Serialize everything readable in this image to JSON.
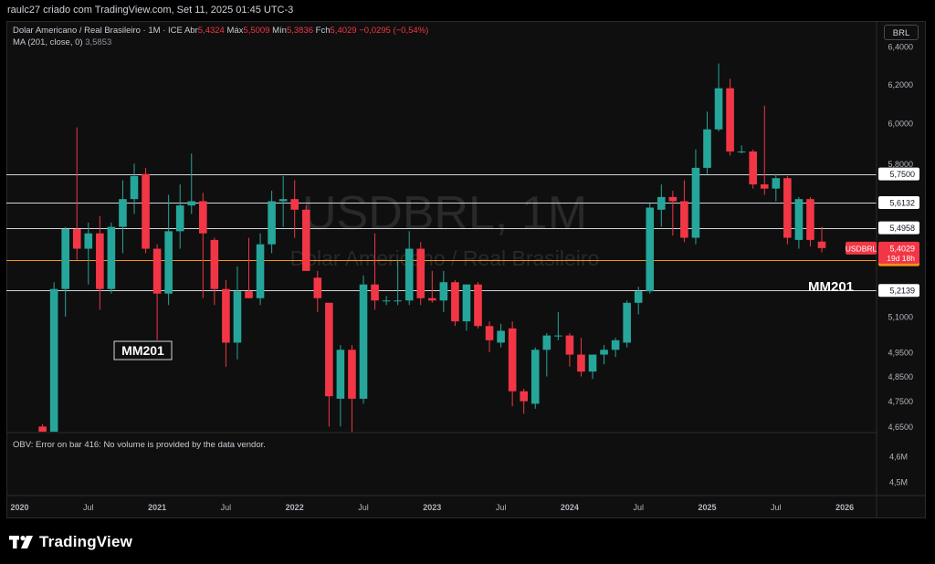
{
  "header": {
    "caption": "raulc27 criado com TradingView.com, Set 11, 2025 01:45 UTC-3"
  },
  "legend": {
    "instrument": "Dolar Americano / Real Brasileiro · 1M · ICE",
    "open_label": "Abr",
    "open_value": "5,4324",
    "high_label": "Máx",
    "high_value": "5,5009",
    "low_label": "Mín",
    "low_value": "5,3836",
    "close_label": "Fch",
    "close_value": "5,4029",
    "change": "−0,0295 (−0,54%)",
    "ma_label": "MA (201, close, 0)",
    "ma_value": "3,5853"
  },
  "currency_button": "BRL",
  "watermark": {
    "symbol": "USDBRL, 1M",
    "name": "Dolar Americano / Real Brasileiro"
  },
  "obv_message": "OBV: Error on bar 416: No volume is provided by the data vendor.",
  "brand": "TradingView",
  "colors": {
    "up": "#26a69a",
    "down": "#f23645",
    "level_line": "#d1d4dc",
    "ma_line": "#f7931a",
    "background": "#0f0f0f"
  },
  "chart_data": {
    "type": "candlestick",
    "interval": "1M",
    "symbol": "USDBRL",
    "y_range": [
      4.63,
      6.44
    ],
    "y_scale": "log",
    "y_ticks": [
      "6,4000",
      "6,2000",
      "6,0000",
      "5,8000",
      "5,1000",
      "4,9500",
      "4,8500",
      "4,7500",
      "4,6500"
    ],
    "volume_ticks": [
      "4,6M",
      "4,5M"
    ],
    "x_labels": [
      "2020",
      "Jul",
      "2021",
      "Jul",
      "2022",
      "Jul",
      "2023",
      "Jul",
      "2024",
      "Jul",
      "2025",
      "Jul",
      "2026"
    ],
    "x_label_months": [
      0,
      6,
      12,
      18,
      24,
      30,
      36,
      42,
      48,
      54,
      60,
      66,
      72
    ],
    "levels": [
      {
        "value": 5.75,
        "label": "5,7500"
      },
      {
        "value": 5.6132,
        "label": "5,6132"
      },
      {
        "value": 5.4958,
        "label": "5,4958"
      },
      {
        "value": 5.2139,
        "label": "5,2139"
      }
    ],
    "ma": {
      "name": "MA (201, close, 0)",
      "value": 5.3503,
      "label": "5,3503",
      "annotations": [
        "MM201",
        "MM201"
      ]
    },
    "last_price": {
      "symbol": "USDBRL",
      "value": 5.4029,
      "label": "5,4029",
      "countdown": "19d 18h"
    },
    "candles": [
      {
        "m": 2,
        "o": 4.65,
        "h": 4.66,
        "l": 4.6,
        "c": 4.63
      },
      {
        "m": 3,
        "o": 4.63,
        "h": 5.25,
        "l": 4.6,
        "c": 5.22
      },
      {
        "m": 4,
        "o": 5.22,
        "h": 5.5,
        "l": 5.1,
        "c": 5.49
      },
      {
        "m": 5,
        "o": 5.49,
        "h": 5.98,
        "l": 5.35,
        "c": 5.4
      },
      {
        "m": 6,
        "o": 5.4,
        "h": 5.52,
        "l": 5.24,
        "c": 5.47
      },
      {
        "m": 7,
        "o": 5.47,
        "h": 5.55,
        "l": 5.13,
        "c": 5.22
      },
      {
        "m": 8,
        "o": 5.22,
        "h": 5.52,
        "l": 5.2,
        "c": 5.5
      },
      {
        "m": 9,
        "o": 5.5,
        "h": 5.72,
        "l": 5.38,
        "c": 5.63
      },
      {
        "m": 10,
        "o": 5.63,
        "h": 5.8,
        "l": 5.56,
        "c": 5.74
      },
      {
        "m": 11,
        "o": 5.75,
        "h": 5.78,
        "l": 5.38,
        "c": 5.4
      },
      {
        "m": 12,
        "o": 5.4,
        "h": 5.42,
        "l": 5.0,
        "c": 5.2
      },
      {
        "m": 13,
        "o": 5.2,
        "h": 5.65,
        "l": 5.15,
        "c": 5.48
      },
      {
        "m": 14,
        "o": 5.48,
        "h": 5.7,
        "l": 5.4,
        "c": 5.6
      },
      {
        "m": 15,
        "o": 5.6,
        "h": 5.85,
        "l": 5.56,
        "c": 5.62
      },
      {
        "m": 16,
        "o": 5.62,
        "h": 5.66,
        "l": 5.18,
        "c": 5.47
      },
      {
        "m": 17,
        "o": 5.44,
        "h": 5.45,
        "l": 5.15,
        "c": 5.22
      },
      {
        "m": 18,
        "o": 5.22,
        "h": 5.26,
        "l": 4.89,
        "c": 4.99
      },
      {
        "m": 19,
        "o": 4.99,
        "h": 5.32,
        "l": 4.92,
        "c": 5.21
      },
      {
        "m": 20,
        "o": 5.21,
        "h": 5.45,
        "l": 5.18,
        "c": 5.18
      },
      {
        "m": 21,
        "o": 5.18,
        "h": 5.47,
        "l": 5.15,
        "c": 5.42
      },
      {
        "m": 22,
        "o": 5.42,
        "h": 5.67,
        "l": 5.38,
        "c": 5.62
      },
      {
        "m": 23,
        "o": 5.62,
        "h": 5.74,
        "l": 5.5,
        "c": 5.63
      },
      {
        "m": 24,
        "o": 5.63,
        "h": 5.72,
        "l": 5.45,
        "c": 5.58
      },
      {
        "m": 25,
        "o": 5.58,
        "h": 5.6,
        "l": 5.3,
        "c": 5.3
      },
      {
        "m": 26,
        "o": 5.27,
        "h": 5.3,
        "l": 5.12,
        "c": 5.18
      },
      {
        "m": 27,
        "o": 5.16,
        "h": 5.16,
        "l": 4.65,
        "c": 4.77
      },
      {
        "m": 28,
        "o": 4.76,
        "h": 4.98,
        "l": 4.65,
        "c": 4.96
      },
      {
        "m": 29,
        "o": 4.96,
        "h": 4.98,
        "l": 4.62,
        "c": 4.76
      },
      {
        "m": 30,
        "o": 4.76,
        "h": 5.28,
        "l": 4.74,
        "c": 5.24
      },
      {
        "m": 31,
        "o": 5.24,
        "h": 5.47,
        "l": 5.13,
        "c": 5.17
      },
      {
        "m": 32,
        "o": 5.17,
        "h": 5.19,
        "l": 5.15,
        "c": 5.17
      },
      {
        "m": 33,
        "o": 5.17,
        "h": 5.35,
        "l": 5.15,
        "c": 5.17
      },
      {
        "m": 34,
        "o": 5.17,
        "h": 5.48,
        "l": 5.15,
        "c": 5.4
      },
      {
        "m": 35,
        "o": 5.4,
        "h": 5.43,
        "l": 5.15,
        "c": 5.18
      },
      {
        "m": 36,
        "o": 5.18,
        "h": 5.3,
        "l": 5.16,
        "c": 5.17
      },
      {
        "m": 37,
        "o": 5.17,
        "h": 5.3,
        "l": 5.12,
        "c": 5.25
      },
      {
        "m": 38,
        "o": 5.25,
        "h": 5.26,
        "l": 5.06,
        "c": 5.08
      },
      {
        "m": 39,
        "o": 5.08,
        "h": 5.24,
        "l": 5.04,
        "c": 5.24
      },
      {
        "m": 40,
        "o": 5.24,
        "h": 5.25,
        "l": 5.05,
        "c": 5.06
      },
      {
        "m": 41,
        "o": 5.06,
        "h": 5.08,
        "l": 4.95,
        "c": 5.0
      },
      {
        "m": 42,
        "o": 4.99,
        "h": 5.07,
        "l": 4.97,
        "c": 5.04
      },
      {
        "m": 43,
        "o": 5.05,
        "h": 5.08,
        "l": 4.73,
        "c": 4.79
      },
      {
        "m": 44,
        "o": 4.79,
        "h": 4.8,
        "l": 4.7,
        "c": 4.75
      },
      {
        "m": 45,
        "o": 4.74,
        "h": 4.97,
        "l": 4.72,
        "c": 4.96
      },
      {
        "m": 46,
        "o": 4.96,
        "h": 5.03,
        "l": 4.85,
        "c": 5.02
      },
      {
        "m": 47,
        "o": 5.02,
        "h": 5.12,
        "l": 5.0,
        "c": 5.02
      },
      {
        "m": 48,
        "o": 5.02,
        "h": 5.03,
        "l": 4.89,
        "c": 4.94
      },
      {
        "m": 49,
        "o": 4.94,
        "h": 5.01,
        "l": 4.85,
        "c": 4.87
      },
      {
        "m": 50,
        "o": 4.87,
        "h": 4.94,
        "l": 4.84,
        "c": 4.94
      },
      {
        "m": 51,
        "o": 4.94,
        "h": 4.98,
        "l": 4.9,
        "c": 4.96
      },
      {
        "m": 52,
        "o": 4.96,
        "h": 5.01,
        "l": 4.93,
        "c": 5.0
      },
      {
        "m": 53,
        "o": 4.99,
        "h": 5.17,
        "l": 4.97,
        "c": 5.16
      },
      {
        "m": 54,
        "o": 5.16,
        "h": 5.23,
        "l": 5.11,
        "c": 5.21
      },
      {
        "m": 55,
        "o": 5.21,
        "h": 5.61,
        "l": 5.2,
        "c": 5.59
      },
      {
        "m": 56,
        "o": 5.58,
        "h": 5.7,
        "l": 5.5,
        "c": 5.64
      },
      {
        "m": 57,
        "o": 5.64,
        "h": 5.67,
        "l": 5.46,
        "c": 5.62
      },
      {
        "m": 58,
        "o": 5.62,
        "h": 5.72,
        "l": 5.43,
        "c": 5.45
      },
      {
        "m": 59,
        "o": 5.45,
        "h": 5.87,
        "l": 5.42,
        "c": 5.78
      },
      {
        "m": 60,
        "o": 5.78,
        "h": 6.06,
        "l": 5.75,
        "c": 5.97
      },
      {
        "m": 61,
        "o": 5.97,
        "h": 6.31,
        "l": 5.96,
        "c": 6.18
      },
      {
        "m": 62,
        "o": 6.18,
        "h": 6.23,
        "l": 5.84,
        "c": 5.86
      },
      {
        "m": 63,
        "o": 5.86,
        "h": 5.89,
        "l": 5.85,
        "c": 5.86
      },
      {
        "m": 64,
        "o": 5.86,
        "h": 5.87,
        "l": 5.68,
        "c": 5.7
      },
      {
        "m": 65,
        "o": 5.7,
        "h": 6.09,
        "l": 5.65,
        "c": 5.68
      },
      {
        "m": 66,
        "o": 5.68,
        "h": 5.75,
        "l": 5.62,
        "c": 5.73
      },
      {
        "m": 67,
        "o": 5.73,
        "h": 5.74,
        "l": 5.42,
        "c": 5.45
      },
      {
        "m": 68,
        "o": 5.44,
        "h": 5.64,
        "l": 5.4,
        "c": 5.63
      },
      {
        "m": 69,
        "o": 5.63,
        "h": 5.64,
        "l": 5.41,
        "c": 5.44
      },
      {
        "m": 70,
        "o": 5.4324,
        "h": 5.5009,
        "l": 5.3836,
        "c": 5.4029
      }
    ]
  }
}
